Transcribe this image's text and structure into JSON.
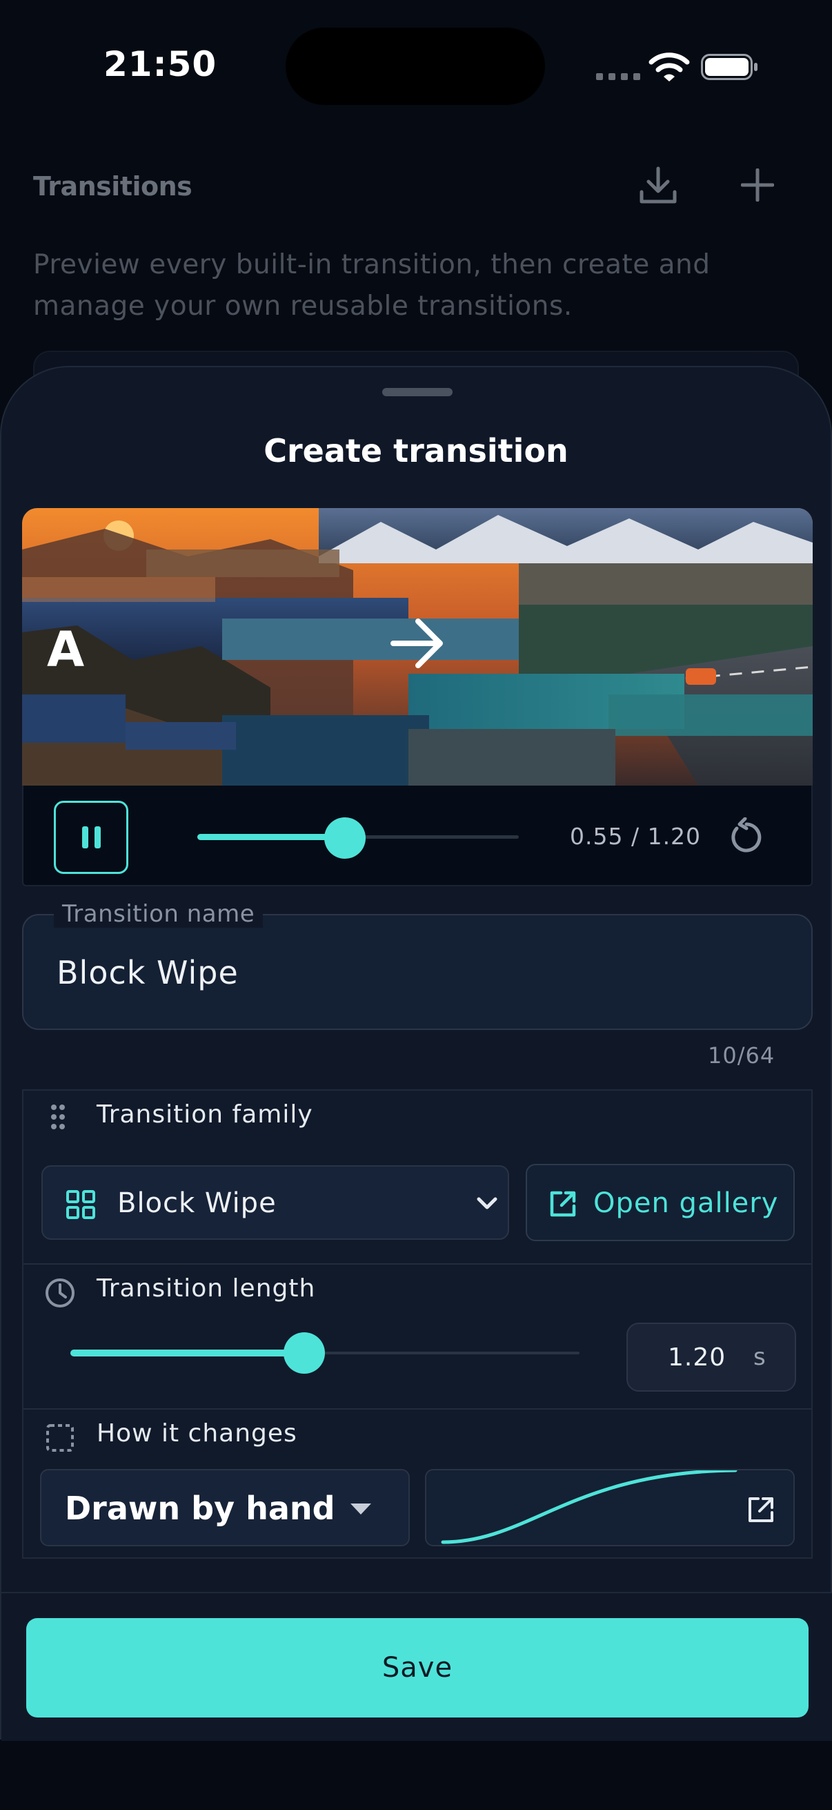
{
  "status_bar": {
    "time": "21:50"
  },
  "background_page": {
    "title": "Transitions",
    "description": "Preview every built-in transition, then create and manage your own reusable transitions."
  },
  "sheet": {
    "title": "Create transition",
    "preview": {
      "label_a": "A",
      "playback": {
        "current": 0.55,
        "total": 1.2,
        "time_text": "0.55 / 1.20"
      }
    },
    "name_field": {
      "label": "Transition name",
      "value": "Block Wipe",
      "counter": "10/64"
    },
    "family": {
      "label": "Transition family",
      "selected": "Block Wipe",
      "gallery_button": "Open gallery"
    },
    "length": {
      "label": "Transition length",
      "value": "1.20",
      "unit": "s",
      "slider_fraction": 0.46
    },
    "easing": {
      "label": "How it changes",
      "selected": "Drawn by hand"
    },
    "save_button": "Save"
  },
  "colors": {
    "accent": "#4ee3d9",
    "sheet_bg": "#101828",
    "page_bg": "#060a12"
  },
  "icons": {
    "download": "download-icon",
    "plus": "plus-icon",
    "replay": "replay-icon",
    "drag": "drag-handle-icon",
    "grid": "grid-icon",
    "chevron": "chevron-down-icon",
    "open_external": "open-external-icon",
    "clock": "clock-icon",
    "dashed_square": "dashed-square-icon",
    "caret": "caret-down-icon",
    "expand": "expand-icon"
  }
}
